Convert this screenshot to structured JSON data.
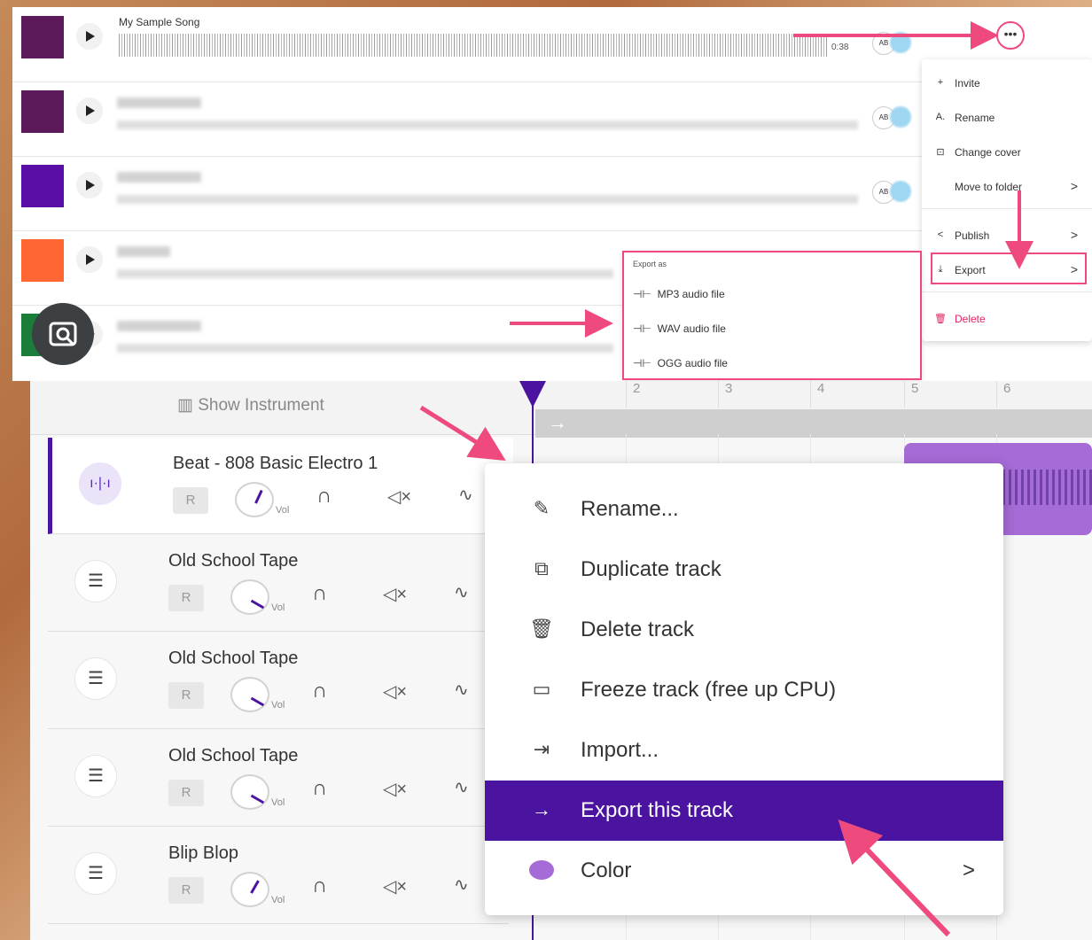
{
  "song_list": {
    "song_title": "My Sample Song",
    "duration": "0:38",
    "cover_colors": [
      "#5c1a5b",
      "#5c1a5b",
      "#5b0ea5",
      "#ff6633",
      "#1b7d3a"
    ],
    "avatar_initials": "AB",
    "more_icon": "more-horizontal-icon"
  },
  "song_menu": {
    "invite": "Invite",
    "rename": "Rename",
    "change_cover": "Change cover",
    "move_to_folder": "Move to folder",
    "publish": "Publish",
    "export": "Export",
    "delete": "Delete"
  },
  "export_submenu": {
    "header": "Export as",
    "mp3": "MP3 audio file",
    "wav": "WAV audio file",
    "ogg": "OGG audio file"
  },
  "timeline": {
    "show_instrument": "Show Instrument",
    "bars": [
      "2",
      "3",
      "4",
      "5",
      "6"
    ]
  },
  "tracks": [
    {
      "name": "Beat - 808 Basic Electro 1",
      "icon": "waveform-icon",
      "selected": true
    },
    {
      "name": "Old School Tape",
      "icon": "drum-icon"
    },
    {
      "name": "Old School Tape",
      "icon": "drum-icon"
    },
    {
      "name": "Old School Tape",
      "icon": "drum-icon"
    },
    {
      "name": "Blip Blop",
      "icon": "drum-icon"
    }
  ],
  "track_controls": {
    "record": "R",
    "vol": "Vol"
  },
  "track_menu": {
    "rename": "Rename...",
    "duplicate": "Duplicate track",
    "delete": "Delete track",
    "freeze": "Freeze track (free up CPU)",
    "import": "Import...",
    "export": "Export this track",
    "color": "Color"
  },
  "colors": {
    "accent": "#4a14a0",
    "highlight_arrow": "#ef4a7e",
    "clip": "#a56bd6"
  }
}
